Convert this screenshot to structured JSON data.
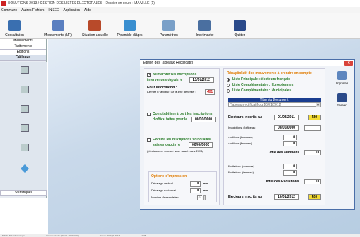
{
  "window": {
    "title": "SOLUTIONS 2013 / GESTION DES LISTES ELECTORALES - Dossier en cours : MA VILLE (1)"
  },
  "menu": [
    "Commune",
    "Autres Fichiers",
    "INSEE",
    "Application",
    "Aide"
  ],
  "toolbar": [
    {
      "label": "Consultation",
      "icon": "people-icon",
      "color": "#3a6fb0"
    },
    {
      "label": "Mouvements (I/R)",
      "icon": "person-arrows-icon",
      "color": "#5a7fc0"
    },
    {
      "label": "Situation actuelle",
      "icon": "group-icon",
      "color": "#b84a2a"
    },
    {
      "label": "Pyramide d'âges",
      "icon": "pyramid-icon",
      "color": "#3a8fd0"
    },
    {
      "label": "Paramètres",
      "icon": "settings-icon",
      "color": "#7aa0c8"
    },
    {
      "label": "Imprimante",
      "icon": "printer-icon",
      "color": "#4a6fa0"
    },
    {
      "label": "Quitter",
      "icon": "exit-door-icon",
      "color": "#2a4a8a"
    }
  ],
  "sidebar": {
    "items": [
      "Mouvements",
      "Traitements",
      "Editions",
      "Tableaux"
    ],
    "bottom": "Statistiques"
  },
  "dialog": {
    "title": "Edition des Tableaux Rectificatifs",
    "close": "x",
    "numeroter": {
      "label1": "Numéroter les inscriptions",
      "label2": "intervenues depuis le",
      "date": "11/01/2012",
      "info_title": "Pour information :",
      "info_text": "Dernier n° attribué sur la liste générale :",
      "info_value": "401"
    },
    "comptabiliser": {
      "label1": "Comptabiliser à part les inscriptions",
      "label2": "d'office faites pour le",
      "date": "00/00/0000"
    },
    "exclure": {
      "label1": "Exclure les inscriptions volontaires",
      "label2": "saisies depuis le",
      "date": "00/00/0000",
      "note": "(électeurs ne pouvant voter avant mars 2013)"
    },
    "impression": {
      "title": "Options d'impression",
      "decalage_v": "Décalage vertical",
      "decalage_v_val": "0",
      "decalage_h": "Décalage horizontal",
      "decalage_h_val": "0",
      "unit": "mm",
      "exemplaires": "Nombre d'exemplaires",
      "exemplaires_val": "3"
    },
    "recap": {
      "title": "Récapitulatif des mouvements à prendre en compte",
      "options": [
        "Liste Principale : électeurs français",
        "Liste Complémentaire : Européennes",
        "Liste Complémentaire : Municipales"
      ],
      "selected": 0,
      "doc_title": "Titre du Document",
      "doc_select": "Tableau rectificatif du 10/01/2012",
      "electeurs_au": "Electeurs inscrits au",
      "date1": "01/03/2011",
      "val1": "420",
      "inscriptions_office": "Inscriptions d'office au",
      "date2": "00/00/0000",
      "additions_h": "Additions (hommes)",
      "additions_h_val": "0",
      "additions_f": "Additions (femmes)",
      "additions_f_val": "0",
      "total_additions": "Total des additions",
      "total_additions_val": "0",
      "radiations_h": "Radiations (hommes)",
      "radiations_h_val": "0",
      "radiations_f": "Radiations (femmes)",
      "radiations_f_val": "0",
      "total_radiations": "Total des Radiations",
      "total_radiations_val": "0",
      "electeurs_au2": "Electeurs inscrits au",
      "date3": "10/01/2012",
      "val3": "420"
    },
    "buttons": {
      "print": "Imprimer",
      "close": "Fermer"
    }
  },
  "status": [
    "NITRA ARS Informatique",
    "Dossier actuelle (Statut 11/01/2012)",
    "Version 2.00 (01/2013)",
    "17:05"
  ]
}
